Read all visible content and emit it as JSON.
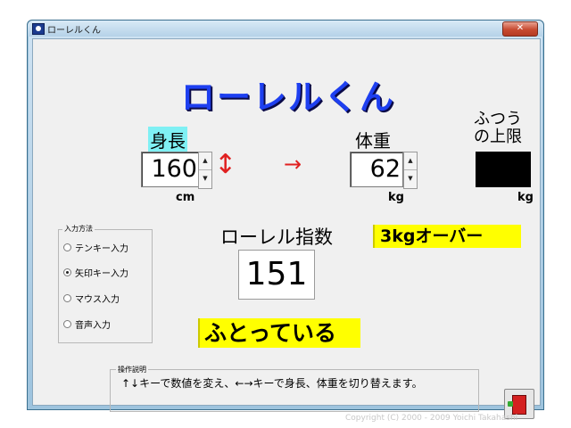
{
  "window": {
    "title": "ローレルくん",
    "close_glyph": "✕"
  },
  "headline": "ローレルくん",
  "height": {
    "label": "身長",
    "value": "160",
    "unit": "cm"
  },
  "arrow_glyph": "→",
  "updown_glyph": "↕",
  "weight": {
    "label": "体重",
    "value": "62",
    "unit": "kg"
  },
  "limit": {
    "label_line1": "ふつう",
    "label_line2": "の上限",
    "unit": "kg"
  },
  "spin_up": "▲",
  "spin_down": "▼",
  "index": {
    "title": "ローレル指数",
    "value": "151"
  },
  "status": {
    "over": "3kgオーバー",
    "result": "ふとっている"
  },
  "input_method": {
    "group_title": "入力方法",
    "options": [
      "テンキー入力",
      "矢印キー入力",
      "マウス入力",
      "音声入力"
    ],
    "selected": "矢印キー入力"
  },
  "help": {
    "title": "操作説明",
    "text": "↑↓キーで数値を変え、←→キーで身長、体重を切り替えます。"
  },
  "copyright": "Copyright (C) 2000 - 2009 Yoichi Takahashi",
  "icons": {
    "app": "app-icon",
    "exit": "door-exit-icon"
  },
  "colors": {
    "headline": "#1e3ff0",
    "height_highlight": "#7ff0f4",
    "status_bg": "#ffff00",
    "arrow": "#e02020"
  }
}
